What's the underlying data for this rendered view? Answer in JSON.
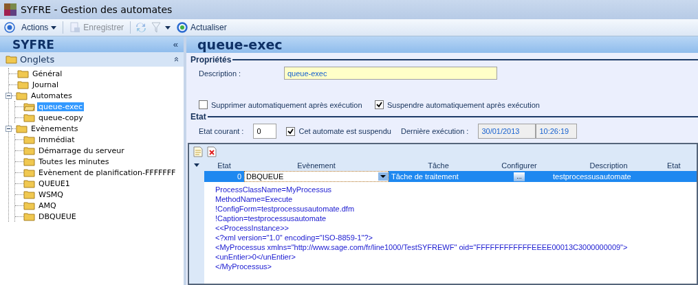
{
  "window": {
    "title": "SYFRE -  Gestion des automates"
  },
  "toolbar": [
    {
      "kind": "menu",
      "label": "Actions",
      "disabled": false
    },
    {
      "kind": "button",
      "label": "Enregistrer",
      "disabled": true
    },
    {
      "kind": "sync",
      "disabled": true
    },
    {
      "kind": "filter",
      "disabled": true
    },
    {
      "kind": "refresh",
      "label": "Actualiser",
      "disabled": false
    }
  ],
  "sidebar": {
    "title": "SYFRE",
    "collapse": "«",
    "section": {
      "label": "Onglets",
      "toggle": "»"
    },
    "items": [
      {
        "label": "Général",
        "selected": false
      },
      {
        "label": "Journal",
        "selected": false
      },
      {
        "label": "Automates",
        "selected": false,
        "expanded": true,
        "children": [
          {
            "label": "queue-exec",
            "selected": true
          },
          {
            "label": "queue-copy",
            "selected": false
          }
        ]
      },
      {
        "label": "Evènements",
        "selected": false,
        "expanded": true,
        "children": [
          {
            "label": "Immédiat",
            "selected": false
          },
          {
            "label": "Démarrage du serveur",
            "selected": false
          },
          {
            "label": "Toutes les minutes",
            "selected": false
          },
          {
            "label": "Evènement de planification-FFFFFFF",
            "selected": false
          },
          {
            "label": "QUEUE1",
            "selected": false
          },
          {
            "label": "WSMQ",
            "selected": false
          },
          {
            "label": "AMQ",
            "selected": false
          },
          {
            "label": "DBQUEUE",
            "selected": false
          }
        ]
      }
    ]
  },
  "detail": {
    "title": "queue-exec",
    "properties": {
      "heading": "Propriétés",
      "description_label": "Description :",
      "description": "queue-exec",
      "options": [
        {
          "label": "Supprimer automatiquement après exécution",
          "checked": false
        },
        {
          "label": "Suspendre automatiquement après exécution",
          "checked": true
        }
      ]
    },
    "state": {
      "heading": "Etat",
      "current_label": "Etat courant :",
      "current": "0",
      "suspended_label": "Cet automate est suspendu",
      "suspended": true,
      "last_run_label": "Dernière exécution :",
      "last_run_date": "30/01/2013",
      "last_run_time": "10:26:19"
    },
    "table": {
      "columns": [
        "Etat",
        "Evènement",
        "Tâche",
        "Configurer",
        "Description",
        "Etat"
      ],
      "rows": [
        {
          "selected": true,
          "state": "0",
          "event": "DBQUEUE",
          "task": "Tâche de traitement",
          "configure": "...",
          "description": "testprocessusautomate"
        }
      ],
      "details": [
        "ProcessClassName=MyProcessus",
        "MethodName=Execute",
        "!ConfigForm=testprocessusautomate.dfm",
        "!Caption=testprocessusautomate",
        "<<ProcessInstance>>",
        "<?xml version=\"1.0\" encoding=\"ISO-8859-1\"?>",
        "<MyProcessus xmlns=\"http://www.sage.com/fr/line1000/TestSYFREWF\" oid=\"FFFFFFFFFFFFEEEE00013C3000000009\">",
        "<unEntier>0</unEntier>",
        "</MyProcessus>"
      ]
    }
  }
}
